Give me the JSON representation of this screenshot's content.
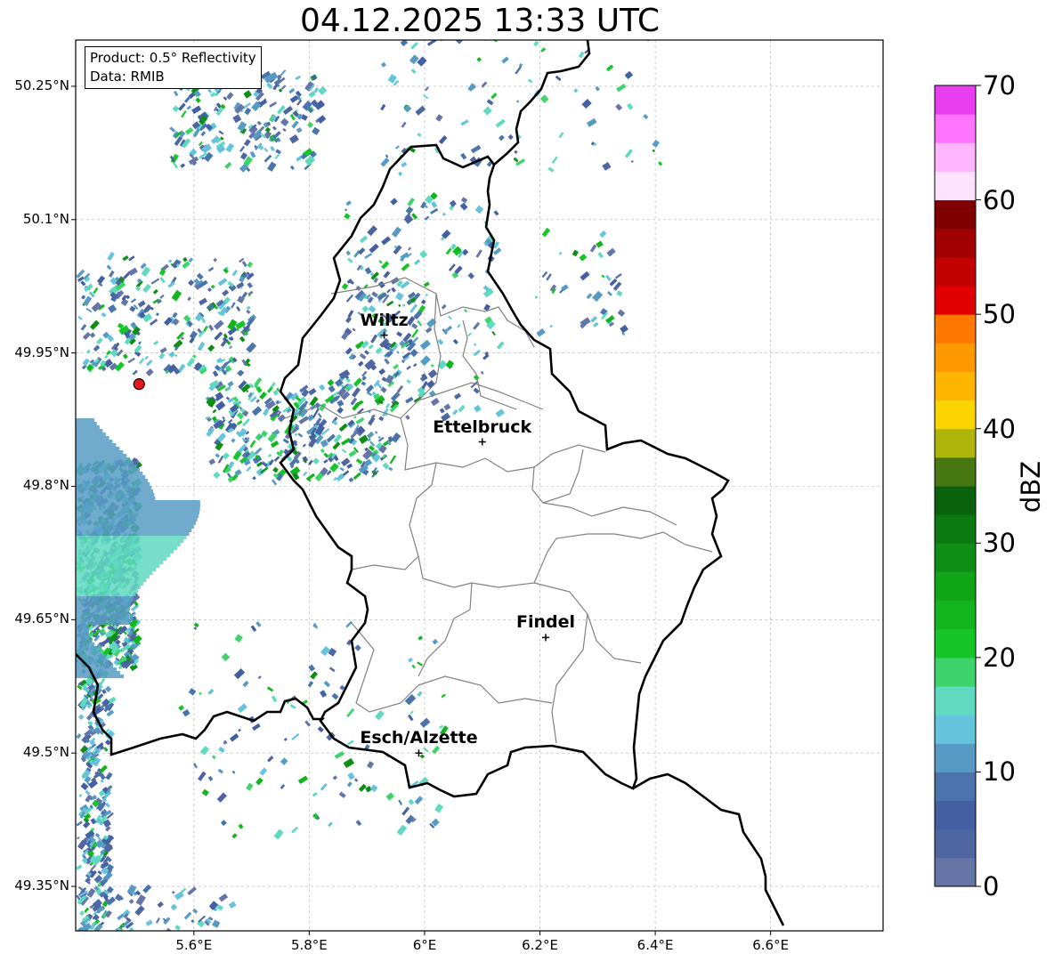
{
  "title": "04.12.2025 13:33 UTC",
  "info": {
    "product": "Product: 0.5° Reflectivity",
    "data_source": "Data: RMIB"
  },
  "axes": {
    "lat_ticks": [
      "50.25°N",
      "50.1°N",
      "49.95°N",
      "49.8°N",
      "49.65°N",
      "49.5°N",
      "49.35°N"
    ],
    "lon_ticks": [
      "5.6°E",
      "5.8°E",
      "6°E",
      "6.2°E",
      "6.4°E",
      "6.6°E"
    ]
  },
  "cities": [
    {
      "name": "Wiltz",
      "lon": 5.93,
      "lat": 49.97
    },
    {
      "name": "Ettelbruck",
      "lon": 6.1,
      "lat": 49.85
    },
    {
      "name": "Findel",
      "lon": 6.21,
      "lat": 49.63
    },
    {
      "name": "Esch/Alzette",
      "lon": 5.99,
      "lat": 49.5
    }
  ],
  "radar_site": {
    "lon": 5.505,
    "lat": 49.915,
    "color": "#e8171d"
  },
  "colorbar": {
    "label": "dBZ",
    "min": 0,
    "max": 70,
    "ticks": [
      "0",
      "10",
      "20",
      "30",
      "40",
      "50",
      "60",
      "70"
    ],
    "colors": [
      "#6575a8",
      "#4f66a0",
      "#4460a3",
      "#4b74ad",
      "#579bc4",
      "#65c3db",
      "#5fd9c0",
      "#3fd46b",
      "#16c628",
      "#12b51d",
      "#10a417",
      "#0e8e14",
      "#0b7a11",
      "#0a620d",
      "#467710",
      "#afb408",
      "#fcd400",
      "#fdb500",
      "#fd9800",
      "#fd7800",
      "#e10000",
      "#c10000",
      "#a00000",
      "#800000",
      "#ffe2ff",
      "#ffb5ff",
      "#ff74ff",
      "#e83ef0"
    ]
  },
  "colors": {
    "country_border": "#000000",
    "canton_border": "#808080",
    "grid": "#b0b0b0"
  }
}
